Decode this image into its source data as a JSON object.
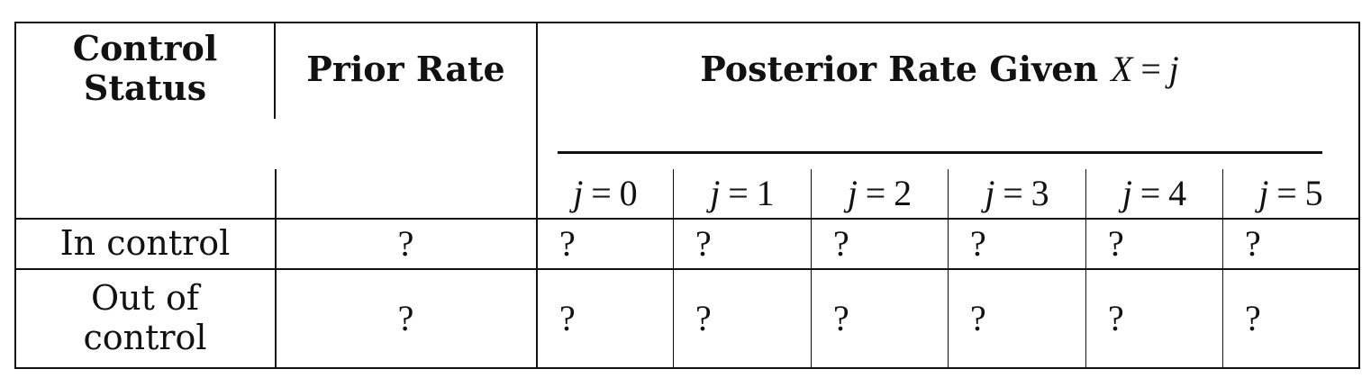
{
  "header": {
    "control_status": [
      "Control",
      "Status"
    ],
    "prior_rate": "Prior Rate",
    "posterior_prefix": "Posterior Rate Given",
    "posterior_var": "X",
    "posterior_eq": "=",
    "posterior_idx": "j"
  },
  "sub_columns": [
    {
      "var": "j",
      "eq": "=",
      "num": "0"
    },
    {
      "var": "j",
      "eq": "=",
      "num": "1"
    },
    {
      "var": "j",
      "eq": "=",
      "num": "2"
    },
    {
      "var": "j",
      "eq": "=",
      "num": "3"
    },
    {
      "var": "j",
      "eq": "=",
      "num": "4"
    },
    {
      "var": "j",
      "eq": "=",
      "num": "5"
    }
  ],
  "rows": [
    {
      "status": [
        "In control"
      ],
      "prior": "?",
      "posterior": [
        "?",
        "?",
        "?",
        "?",
        "?",
        "?"
      ]
    },
    {
      "status": [
        "Out of",
        "control"
      ],
      "prior": "?",
      "posterior": [
        "?",
        "?",
        "?",
        "?",
        "?",
        "?"
      ]
    }
  ]
}
